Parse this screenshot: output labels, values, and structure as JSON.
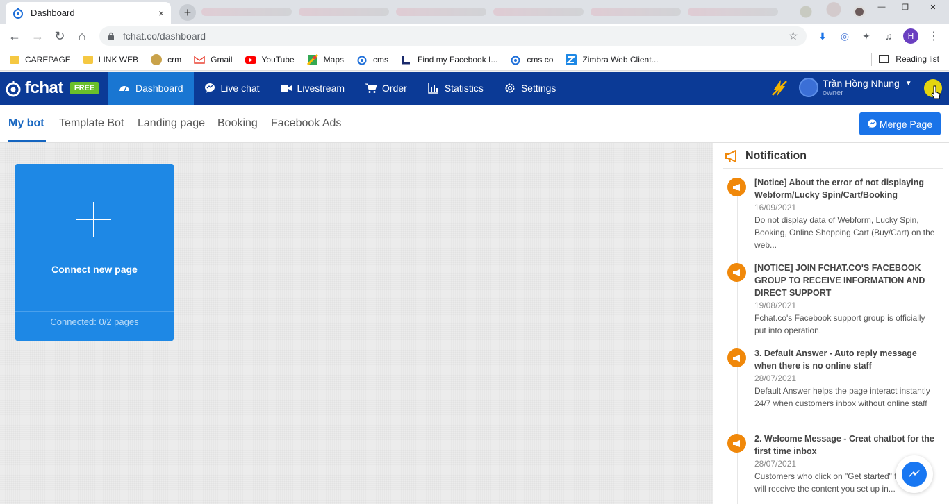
{
  "browser": {
    "tab_title": "Dashboard",
    "tab_close": "×",
    "new_tab": "+",
    "url": "fchat.co/dashboard",
    "profile_initial": "H",
    "bookmarks": [
      {
        "label": "CAREPAGE",
        "icon": "folder-icon"
      },
      {
        "label": "LINK WEB",
        "icon": "folder-icon"
      },
      {
        "label": "crm",
        "icon": "crm-favicon"
      },
      {
        "label": "Gmail",
        "icon": "gmail-icon"
      },
      {
        "label": "YouTube",
        "icon": "youtube-icon"
      },
      {
        "label": "Maps",
        "icon": "maps-icon"
      },
      {
        "label": "cms",
        "icon": "fchat-icon"
      },
      {
        "label": "Find my Facebook I...",
        "icon": "l-favicon"
      },
      {
        "label": "cms co",
        "icon": "fchat-icon"
      },
      {
        "label": "Zimbra Web Client...",
        "icon": "zimbra-icon"
      }
    ],
    "reading_list": "Reading list"
  },
  "app": {
    "logo_text": "fchat",
    "plan_badge": "FREE",
    "nav": [
      {
        "label": "Dashboard",
        "icon": "dashboard-icon",
        "active": true
      },
      {
        "label": "Live chat",
        "icon": "chat-bubble-icon",
        "active": false
      },
      {
        "label": "Livestream",
        "icon": "video-camera-icon",
        "active": false
      },
      {
        "label": "Order",
        "icon": "cart-icon",
        "active": false
      },
      {
        "label": "Statistics",
        "icon": "bar-chart-icon",
        "active": false
      },
      {
        "label": "Settings",
        "icon": "gear-icon",
        "active": false
      }
    ],
    "user": {
      "name": "Trần Hồng Nhung",
      "role": "owner"
    }
  },
  "subtabs": {
    "items": [
      "My bot",
      "Template Bot",
      "Landing page",
      "Booking",
      "Facebook Ads"
    ],
    "active": "My bot",
    "merge_button": "Merge Page"
  },
  "connect_card": {
    "title": "Connect new page",
    "footer": "Connected: 0/2 pages"
  },
  "notifications": {
    "heading": "Notification",
    "items": [
      {
        "title": "[Notice] About the error of not displaying Webform/Lucky Spin/Cart/Booking",
        "date": "16/09/2021",
        "desc": "Do not display data of Webform, Lucky Spin, Booking, Online Shopping Cart (Buy/Cart) on the web..."
      },
      {
        "title": "[NOTICE] JOIN FCHAT.CO'S FACEBOOK GROUP TO RECEIVE INFORMATION AND DIRECT SUPPORT",
        "date": "19/08/2021",
        "desc": "Fchat.co's Facebook support group is officially put into operation."
      },
      {
        "title": "3. Default Answer - Auto reply message when there is no online staff",
        "date": "28/07/2021",
        "desc": "Default Answer helps the page interact instantly 24/7 when customers inbox without online staff"
      },
      {
        "title": "2. Welcome Message - Creat chatbot for the first time inbox",
        "date": "28/07/2021",
        "desc": "Customers who click on \"Get started\" first inbox will receive the content you set up in..."
      }
    ]
  },
  "colors": {
    "nav_bg": "#0b3a96",
    "nav_active": "#1976d2",
    "accent": "#1a73e8",
    "card": "#1e88e5",
    "notif_dot": "#f0880a",
    "badge_free": "#6abf2a"
  }
}
